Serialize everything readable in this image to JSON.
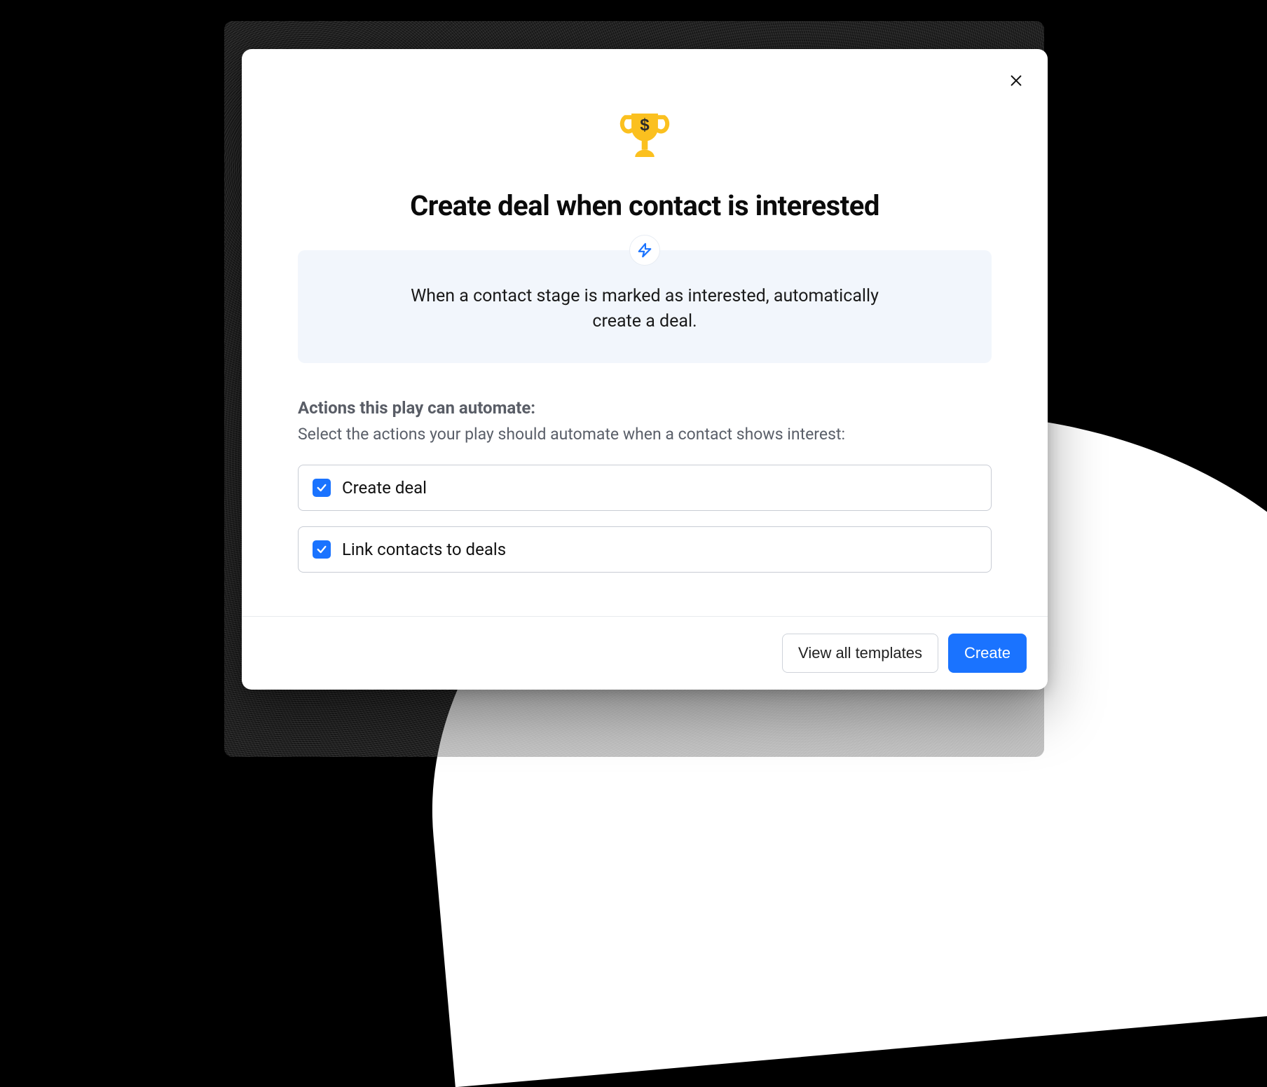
{
  "modal": {
    "title": "Create deal when contact is interested",
    "description": "When a contact stage is marked as interested, automatically create a deal.",
    "section": {
      "heading": "Actions this play can automate:",
      "sub": "Select the actions your play should automate when a contact shows interest:"
    },
    "options": [
      {
        "label": "Create deal",
        "checked": true
      },
      {
        "label": "Link contacts to deals",
        "checked": true
      }
    ],
    "footer": {
      "secondary": "View all templates",
      "primary": "Create"
    }
  }
}
